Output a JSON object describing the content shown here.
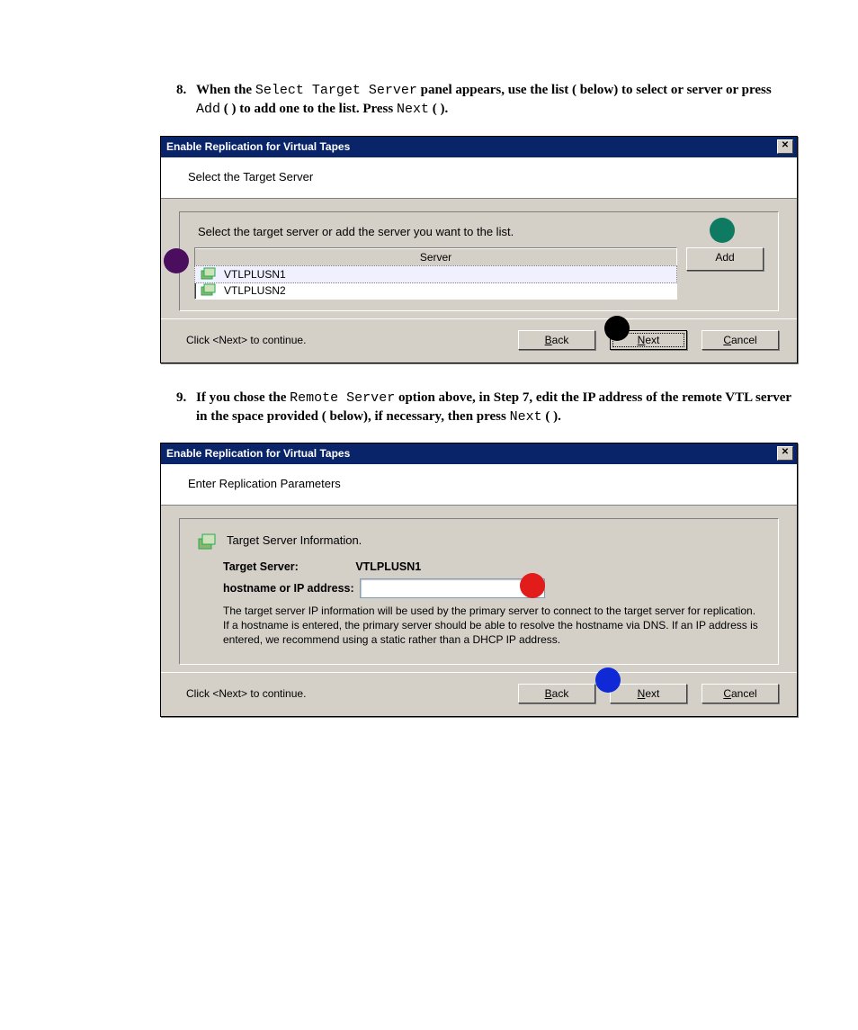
{
  "steps": {
    "s8": {
      "num": "8.",
      "part1": "When the ",
      "code1": "Select Target Server",
      "part2": " panel appears, use the list (  below) to select or server or press ",
      "code2": "Add",
      "part3": " (  ) to add one to the list. Press ",
      "code3": "Next",
      "part4": " (  )."
    },
    "s9": {
      "num": "9.",
      "part1": "If you chose the ",
      "code1": "Remote Server",
      "part2": " option above, in Step 7, edit the IP address of the remote VTL server in the space provided (   below), if necessary, then press ",
      "code2": "Next",
      "part3": " (  )."
    }
  },
  "dialog1": {
    "title": "Enable Replication for Virtual Tapes",
    "close": "✕",
    "subheader": "Select the Target Server",
    "instr": "Select the target server or add the server you want to the list.",
    "server_hdr": "Server",
    "servers": [
      "VTLPLUSN1",
      "VTLPLUSN2"
    ],
    "add": "Add",
    "hint": "Click <Next> to continue.",
    "back": "Back",
    "next": "Next",
    "cancel": "Cancel"
  },
  "dialog2": {
    "title": "Enable Replication for Virtual Tapes",
    "close": "✕",
    "subheader": "Enter Replication Parameters",
    "heading": "Target Server Information.",
    "target_label": "Target Server:",
    "target_value": "VTLPLUSN1",
    "ip_label": "hostname or IP address:",
    "ip_value": "",
    "desc": "The target server IP information will be used by the primary server to connect to the target server for replication. If a hostname is entered, the primary server should be able to resolve the hostname via DNS. If an IP address is entered, we recommend using a static rather than a DHCP IP address.",
    "hint": "Click <Next> to continue.",
    "back": "Back",
    "next": "Next",
    "cancel": "Cancel"
  },
  "markers": {
    "purple": "#4b0d5e",
    "teal": "#0f7a62",
    "black": "#000000",
    "red": "#e21b1b",
    "blue": "#1029d6"
  }
}
